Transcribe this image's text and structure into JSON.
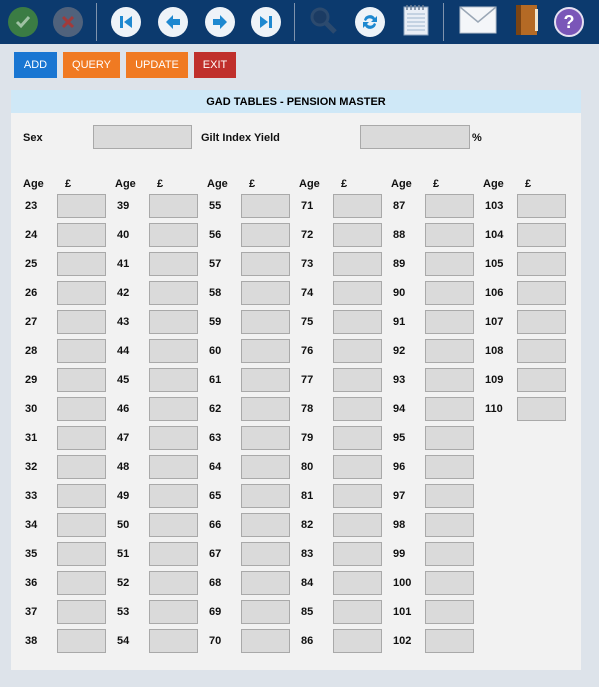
{
  "toolbar": {
    "icons": [
      "check-icon",
      "cancel-icon",
      "first-record-icon",
      "previous-record-icon",
      "next-record-icon",
      "last-record-icon",
      "search-icon",
      "refresh-icon",
      "notepad-icon",
      "email-icon",
      "address-book-icon",
      "help-icon"
    ],
    "help_glyph": "?"
  },
  "actions": {
    "add": "ADD",
    "query": "QUERY",
    "update": "UPDATE",
    "exit": "EXIT"
  },
  "colors": {
    "toolbar": "#0c3a6e",
    "add": "#1976d2",
    "query": "#f07a22",
    "update": "#f07a22",
    "exit": "#c0302c",
    "title_bar": "#cfe8f7"
  },
  "form": {
    "title": "GAD TABLES - PENSION MASTER",
    "sex_label": "Sex",
    "sex_value": "",
    "gilt_label": "Gilt Index Yield",
    "gilt_value": "",
    "percent": "%",
    "age_header": "Age",
    "pound_header": "£",
    "columns": [
      [
        "23",
        "24",
        "25",
        "26",
        "27",
        "28",
        "29",
        "30",
        "31",
        "32",
        "33",
        "34",
        "35",
        "36",
        "37",
        "38"
      ],
      [
        "39",
        "40",
        "41",
        "42",
        "43",
        "44",
        "45",
        "46",
        "47",
        "48",
        "49",
        "50",
        "51",
        "52",
        "53",
        "54"
      ],
      [
        "55",
        "56",
        "57",
        "58",
        "59",
        "60",
        "61",
        "62",
        "63",
        "64",
        "65",
        "66",
        "67",
        "68",
        "69",
        "70"
      ],
      [
        "71",
        "72",
        "73",
        "74",
        "75",
        "76",
        "77",
        "78",
        "79",
        "80",
        "81",
        "82",
        "83",
        "84",
        "85",
        "86"
      ],
      [
        "87",
        "88",
        "89",
        "90",
        "91",
        "92",
        "93",
        "94",
        "95",
        "96",
        "97",
        "98",
        "99",
        "100",
        "101",
        "102"
      ],
      [
        "103",
        "104",
        "105",
        "106",
        "107",
        "108",
        "109",
        "110"
      ]
    ]
  }
}
